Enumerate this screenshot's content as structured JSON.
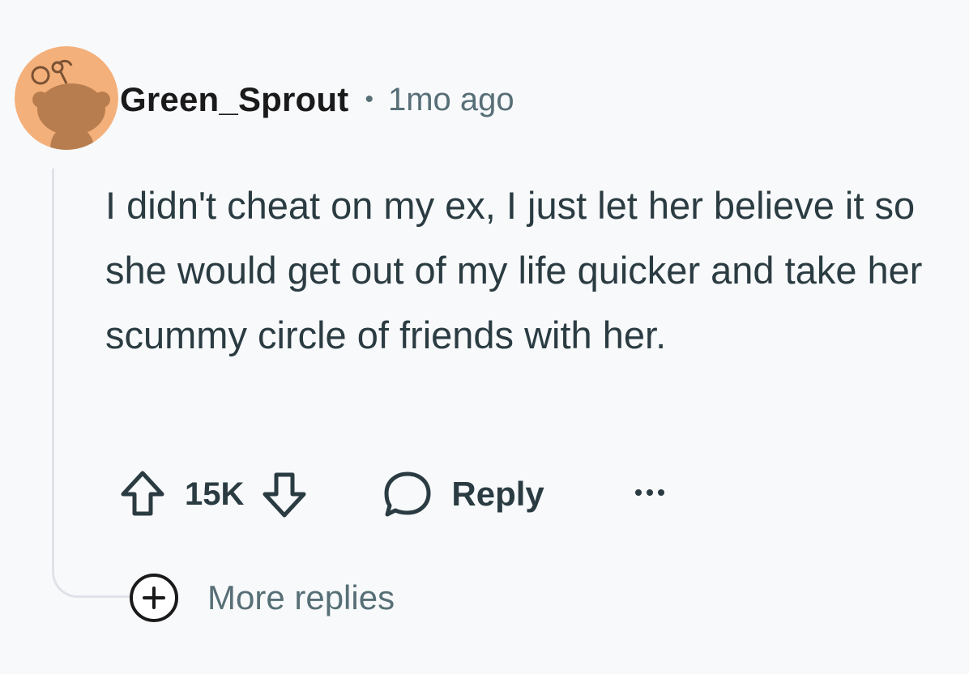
{
  "comment": {
    "username": "Green_Sprout",
    "separator": "•",
    "timestamp": "1mo ago",
    "body": "I didn't cheat on my ex, I just let her believe it so she would get out of my life quicker and take her scummy circle of friends with her.",
    "avatar_icon": "snoo-avatar-icon",
    "avatar_bg": "#f4b07a"
  },
  "actions": {
    "upvote_icon": "arrow-up-icon",
    "vote_count": "15K",
    "downvote_icon": "arrow-down-icon",
    "reply_icon": "speech-bubble-icon",
    "reply_label": "Reply",
    "more_icon": "ellipsis-icon"
  },
  "thread": {
    "more_replies_icon": "plus-circle-icon",
    "more_replies_label": "More replies"
  },
  "colors": {
    "background": "#f8f9fb",
    "text_primary": "#1a1a1b",
    "text_body": "#2a3c42",
    "text_meta": "#576f76",
    "thread_line": "#dfe3e8"
  }
}
